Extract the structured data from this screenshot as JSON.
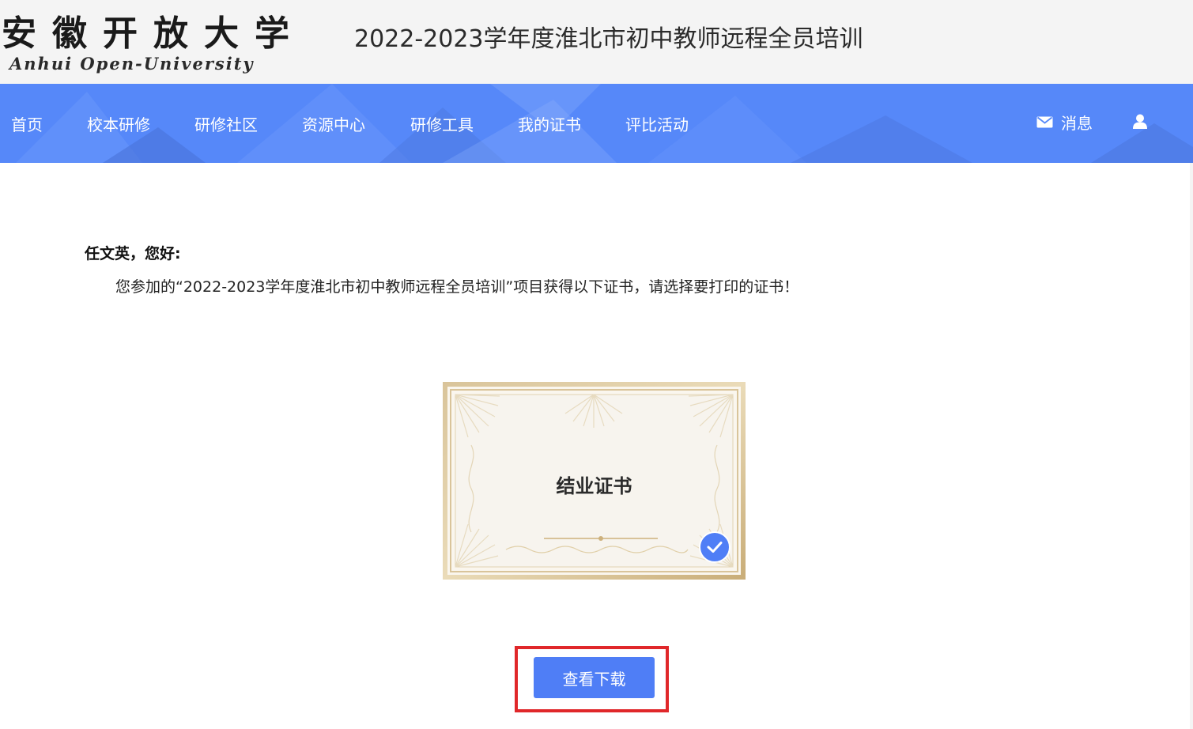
{
  "header": {
    "logo_cn": "安徽开放大学",
    "logo_en": "Anhui Open-University",
    "title": "2022-2023学年度淮北市初中教师远程全员培训"
  },
  "nav": {
    "items": [
      {
        "label": "首页"
      },
      {
        "label": "校本研修"
      },
      {
        "label": "研修社区"
      },
      {
        "label": "资源中心"
      },
      {
        "label": "研修工具"
      },
      {
        "label": "我的证书"
      },
      {
        "label": "评比活动"
      }
    ],
    "messages_label": "消息",
    "messages_icon": "mail-icon",
    "user_icon": "user-icon",
    "color": "#5688f9"
  },
  "main": {
    "greeting": "任文英，您好:",
    "message": "您参加的“2022-2023学年度淮北市初中教师远程全员培训”项目获得以下证书，请选择要打印的证书！",
    "certificate": {
      "title": "结业证书",
      "selected": true,
      "check_icon": "check-icon"
    },
    "view_download_button": "查看下载",
    "button_color": "#4f7ef6",
    "highlight_color": "#e0272a"
  }
}
